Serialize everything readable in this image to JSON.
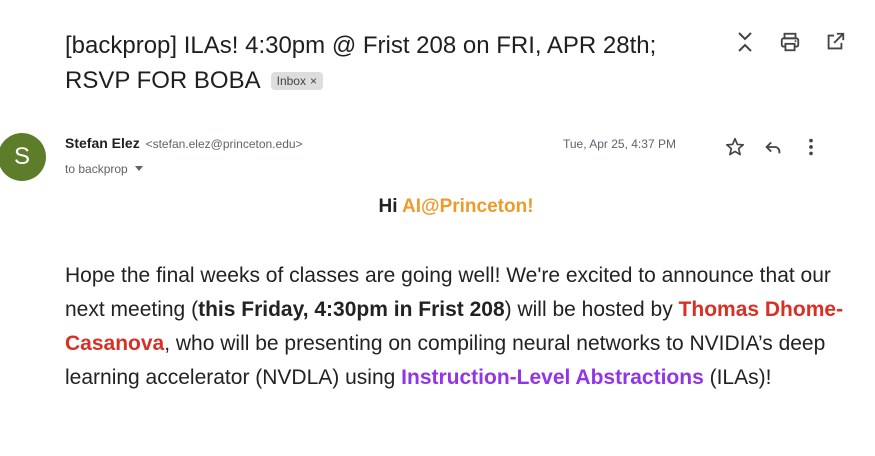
{
  "subject": {
    "title": "[backprop] ILAs! 4:30pm @ Frist 208 on FRI, APR 28th; RSVP FOR BOBA",
    "label": "Inbox",
    "label_close": "×"
  },
  "top_actions": [
    "expand-collapse-icon",
    "print-icon",
    "open-in-new-window-icon"
  ],
  "sender": {
    "avatar_letter": "S",
    "avatar_color": "#5e7d2a",
    "name": "Stefan Elez",
    "email": "<stefan.elez@princeton.edu>",
    "to": "to backprop",
    "date": "Tue, Apr 25, 4:37 PM"
  },
  "message_actions": [
    "star-icon",
    "reply-icon",
    "more-options-icon"
  ],
  "body": {
    "greeting_prefix": "Hi ",
    "greeting_org": "AI@Princeton!",
    "p1": "Hope the final weeks of classes are going well! We're excited to announce that our next meeting (",
    "p1_bold": "this Friday, 4:30pm in Frist 208",
    "p2": ") will be hosted by ",
    "speaker": "Thomas Dhome-Casanova",
    "p3": ", who will be presenting on compiling neural networks to NVIDIA’s deep learning accelerator (NVDLA) using ",
    "topic": "Instruction-Level Abstractions",
    "p4": " (ILAs)!"
  },
  "colors": {
    "org": "#ee9b2c",
    "speaker": "#d93025",
    "topic": "#9334e6"
  }
}
